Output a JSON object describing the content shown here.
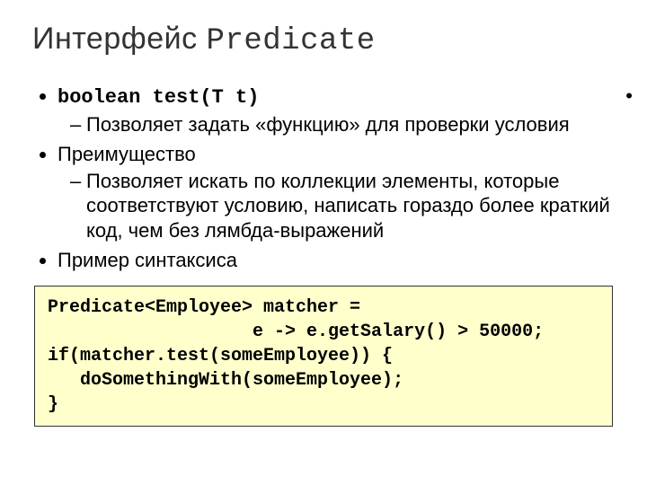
{
  "title_prefix": "Интерфейс ",
  "title_code": "Predicate",
  "bullets": {
    "sig": "boolean test(T t)",
    "sig_desc": "Позволяет задать «функцию» для проверки условия",
    "adv_label": "Преимущество",
    "adv_desc": "Позволяет искать по коллекции элементы, которые соответствуют условию, написать гораздо более краткий код, чем без лямбда-выражений",
    "syntax_label": "Пример синтаксиса"
  },
  "code": "Predicate<Employee> matcher =\n                   e -> e.getSalary() > 50000;\nif(matcher.test(someEmployee)) {\n   doSomethingWith(someEmployee);\n}",
  "trail_marker": "•"
}
